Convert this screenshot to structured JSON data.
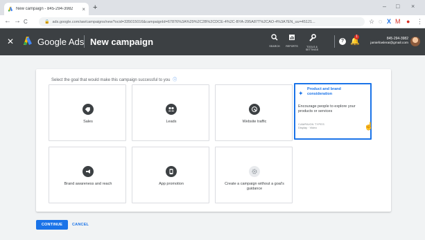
{
  "browser": {
    "tab_title": "New campaign - 845-294-3982",
    "tab_close": "×",
    "new_tab": "+",
    "url": "ads.google.com/aw/campaigns/new?ocid=335015016&campaignId=67876%3A%29%2C2B%2CDCE-4%2C-BYA-295A87T%2CAO-4%3A7EN_uu=45121...",
    "win_min": "–",
    "win_max": "□",
    "win_close": "×",
    "back": "←",
    "forward": "→",
    "reload": "C"
  },
  "header": {
    "brand": "Google Ads",
    "page_title": "New campaign",
    "tools": [
      {
        "label": "SEARCH",
        "icon": "search-icon"
      },
      {
        "label": "REPORTS",
        "icon": "reports-icon"
      },
      {
        "label": "TOOLS & SETTINGS",
        "icon": "wrench-icon"
      }
    ],
    "help": "?",
    "notification_count": "1",
    "account_phone": "845-294-3982",
    "account_email": "jamiefowlerai@gmail.com"
  },
  "main": {
    "prompt": "Select the goal that would make this campaign successful to you",
    "goals": [
      {
        "label": "Sales",
        "icon": "tag-icon"
      },
      {
        "label": "Leads",
        "icon": "people-icon"
      },
      {
        "label": "Website traffic",
        "icon": "cursor-click-icon"
      },
      {
        "label": "Brand awareness and reach",
        "icon": "megaphone-icon"
      },
      {
        "label": "App promotion",
        "icon": "phone-icon"
      },
      {
        "label": "Create a campaign without a goal's guidance",
        "icon": "gear-icon"
      }
    ],
    "selected_goal": {
      "title": "Product and brand consideration",
      "description": "Encourage people to explore your products or services",
      "types_label": "CAMPAIGN TYPES",
      "types_value": "Display · Video"
    }
  },
  "footer": {
    "continue_label": "CONTINUE",
    "cancel_label": "CANCEL"
  },
  "colors": {
    "accent": "#1a73e8",
    "header_bg": "#3c4043"
  }
}
